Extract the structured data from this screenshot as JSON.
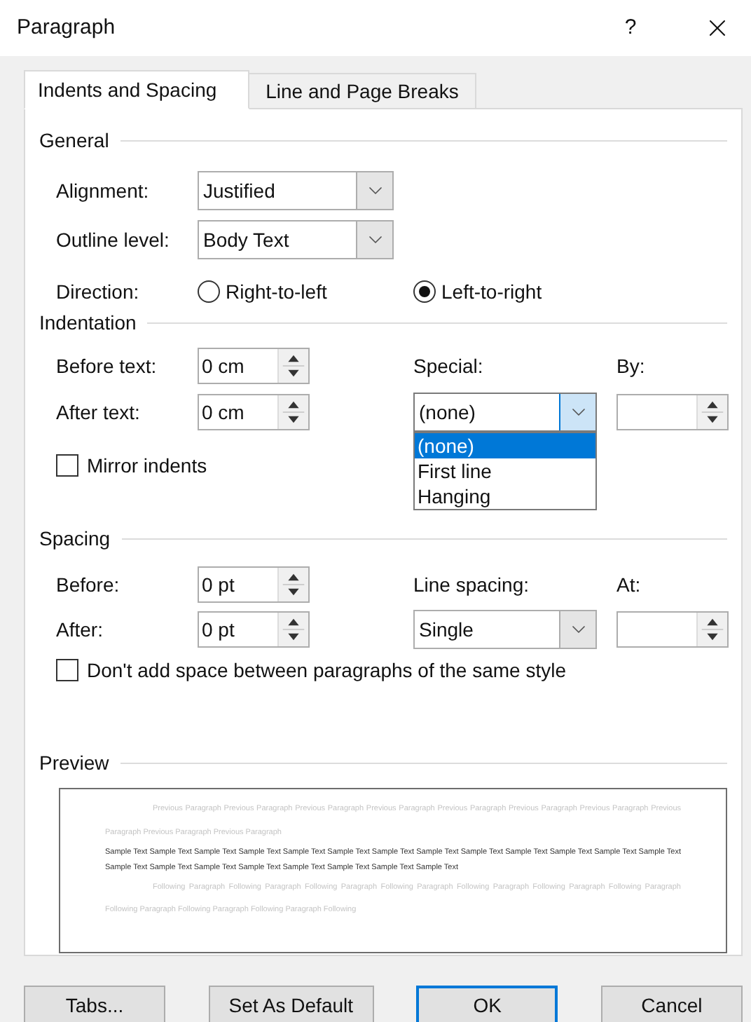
{
  "window": {
    "title": "Paragraph",
    "help_button": "?"
  },
  "tabs": [
    {
      "label": "Indents and Spacing",
      "selected": true
    },
    {
      "label": "Line and Page Breaks",
      "selected": false
    }
  ],
  "general": {
    "heading": "General",
    "alignment": {
      "label": "Alignment:",
      "value": "Justified"
    },
    "outline_level": {
      "label": "Outline level:",
      "value": "Body Text"
    },
    "direction": {
      "label": "Direction:",
      "options": [
        {
          "label": "Right-to-left",
          "selected": false
        },
        {
          "label": "Left-to-right",
          "selected": true
        }
      ]
    }
  },
  "indentation": {
    "heading": "Indentation",
    "before_text": {
      "label": "Before text:",
      "value": "0 cm"
    },
    "after_text": {
      "label": "After text:",
      "value": "0 cm"
    },
    "special": {
      "label": "Special:",
      "value": "(none)",
      "expanded": true,
      "options": [
        {
          "label": "(none)",
          "selected": true
        },
        {
          "label": "First line",
          "selected": false
        },
        {
          "label": "Hanging",
          "selected": false
        }
      ]
    },
    "by": {
      "label": "By:"
    },
    "mirror_indents": {
      "label": "Mirror indents",
      "checked": false
    }
  },
  "spacing": {
    "heading": "Spacing",
    "before": {
      "label": "Before:",
      "value": "0 pt"
    },
    "after": {
      "label": "After:",
      "value": "0 pt"
    },
    "line_spacing": {
      "label": "Line spacing:",
      "value": "Single",
      "expanded": false
    },
    "at": {
      "label": "At:"
    },
    "dont_add_space": {
      "label": "Don't add space between paragraphs of the same style",
      "checked": false
    }
  },
  "preview": {
    "heading": "Preview",
    "previous": "Previous Paragraph Previous Paragraph Previous Paragraph Previous Paragraph Previous Paragraph Previous Paragraph Previous Paragraph Previous Paragraph Previous Paragraph Previous Paragraph",
    "sample": "Sample Text Sample Text Sample Text Sample Text Sample Text Sample Text Sample Text Sample Text Sample Text Sample Text Sample Text Sample Text Sample Text Sample Text Sample Text Sample Text Sample Text Sample Text Sample Text Sample Text Sample Text",
    "following": "Following Paragraph Following Paragraph Following Paragraph Following Paragraph Following Paragraph Following Paragraph Following Paragraph Following Paragraph Following Paragraph Following Paragraph Following"
  },
  "buttons": [
    {
      "label": "Tabs...",
      "default": false
    },
    {
      "label": "Set As Default",
      "default": false
    },
    {
      "label": "OK",
      "default": true
    },
    {
      "label": "Cancel",
      "default": false
    }
  ]
}
